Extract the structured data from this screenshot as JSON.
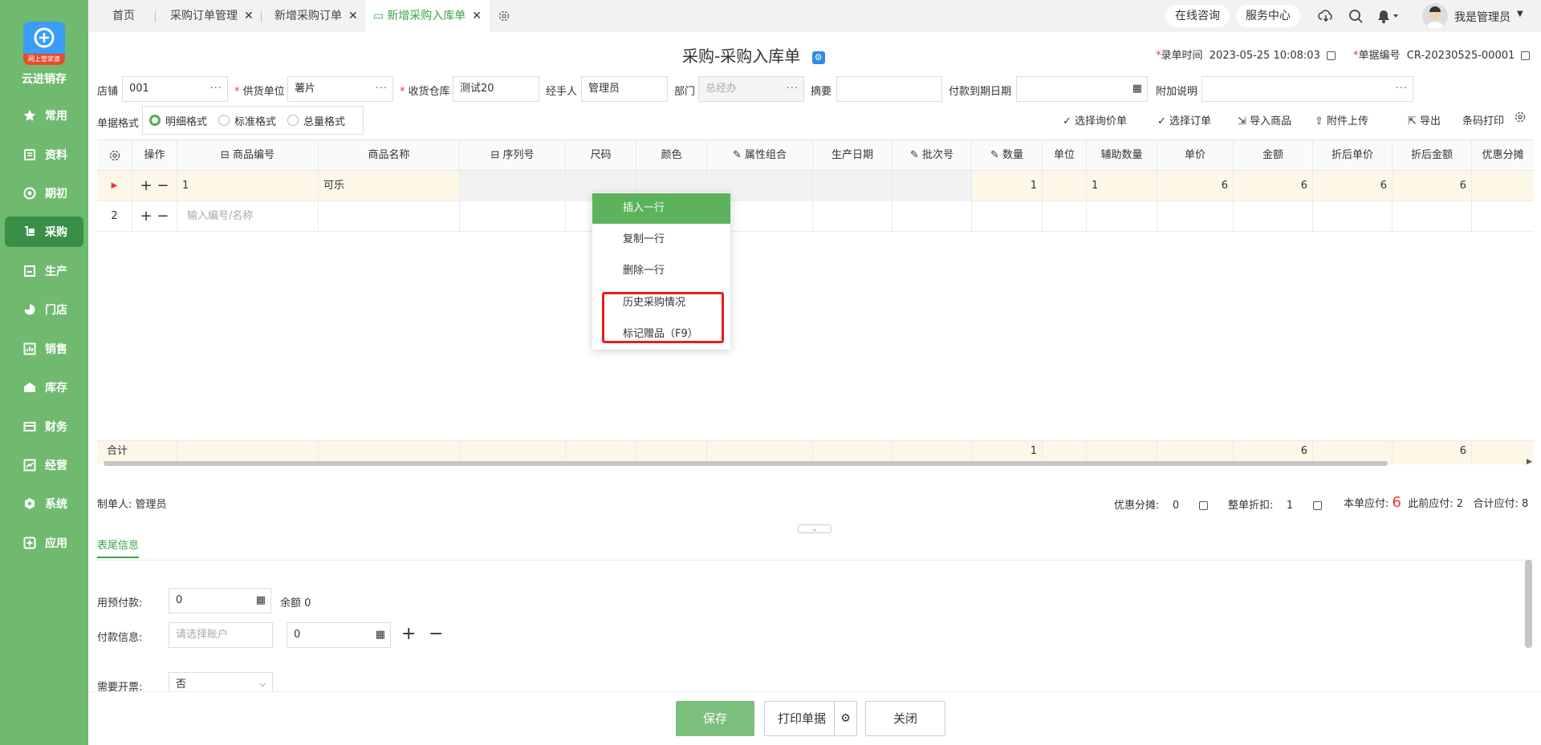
{
  "app": {
    "name": "云进销存",
    "logo_tag": "网上管家婆"
  },
  "sidebar": {
    "items": [
      {
        "label": "常用",
        "icon": "star-icon",
        "active": false
      },
      {
        "label": "资料",
        "icon": "document-icon",
        "active": false
      },
      {
        "label": "期初",
        "icon": "target-icon",
        "active": false
      },
      {
        "label": "采购",
        "icon": "cart-icon",
        "active": true
      },
      {
        "label": "生产",
        "icon": "factory-icon",
        "active": false
      },
      {
        "label": "门店",
        "icon": "pie-icon",
        "active": false
      },
      {
        "label": "销售",
        "icon": "bar-chart-icon",
        "active": false
      },
      {
        "label": "库存",
        "icon": "warehouse-icon",
        "active": false
      },
      {
        "label": "财务",
        "icon": "finance-icon",
        "active": false
      },
      {
        "label": "经营",
        "icon": "trend-icon",
        "active": false
      },
      {
        "label": "系统",
        "icon": "hexagon-gear-icon",
        "active": false
      },
      {
        "label": "应用",
        "icon": "plus-square-icon",
        "active": false
      }
    ]
  },
  "tabs": [
    {
      "label": "首页"
    },
    {
      "label": "采购订单管理"
    },
    {
      "label": "新增采购订单"
    },
    {
      "label": "新增采购入库单",
      "active": true
    }
  ],
  "topbar": {
    "consult": "在线咨询",
    "service": "服务中心",
    "user": "我是管理员"
  },
  "form": {
    "title": "采购-采购入库单",
    "record_time_label": "录单时间",
    "record_time": "2023-05-25 10:08:03",
    "doc_no_label": "单据编号",
    "doc_no": "CR-20230525-00001",
    "store_label": "店铺",
    "store": "001",
    "supplier_label": "供货单位",
    "supplier": "薯片",
    "warehouse_label": "收货仓库",
    "warehouse": "测试20",
    "handler_label": "经手人",
    "handler": "管理员",
    "dept_label": "部门",
    "dept": "总经办",
    "summary_label": "摘要",
    "summary": "",
    "due_label": "付款到期日期",
    "due": "",
    "note_label": "附加说明",
    "note": "",
    "format_label": "单据格式",
    "formats": [
      "明细格式",
      "标准格式",
      "总量格式"
    ],
    "format_selected": 0
  },
  "toolbar": {
    "inquiry": "选择询价单",
    "order": "选择订单",
    "import": "导入商品",
    "attach": "附件上传",
    "export": "导出",
    "barcode": "条码打印"
  },
  "grid": {
    "headers": [
      "操作",
      "商品编号",
      "商品名称",
      "序列号",
      "尺码",
      "颜色",
      "属性组合",
      "生产日期",
      "批次号",
      "数量",
      "单位",
      "辅助数量",
      "单价",
      "金额",
      "折后单价",
      "折后金额",
      "优惠分摊"
    ],
    "rows": [
      {
        "idx": "",
        "code": "1",
        "name": "可乐",
        "qty": "1",
        "aux": "1",
        "price": "6",
        "amount": "6",
        "disc_price": "6",
        "disc_amount": "6"
      },
      {
        "idx": "2",
        "code_placeholder": "输入编号/名称"
      }
    ],
    "total_label": "合计",
    "total_qty": "1",
    "total_amount": "6",
    "total_disc_amount": "6"
  },
  "context_menu": {
    "items": [
      "插入一行",
      "复制一行",
      "删除一行",
      "历史采购情况",
      "标记赠品（F9）"
    ]
  },
  "footer_info": {
    "maker_label": "制单人:",
    "maker": "管理员",
    "discount_share_label": "优惠分摊:",
    "discount_share": "0",
    "whole_discount_label": "整单折扣:",
    "whole_discount": "1",
    "payable_label": "本单应付:",
    "payable": "6",
    "prev_payable": "此前应付: 2",
    "total_payable": "合计应付: 8"
  },
  "tail": {
    "tab": "表尾信息",
    "prepay_label": "用预付款:",
    "prepay": "0",
    "balance": "余额 0",
    "payinfo_label": "付款信息:",
    "account_placeholder": "请选择账户",
    "payinfo_amount": "0",
    "invoice_label": "需要开票:",
    "invoice": "否"
  },
  "buttons": {
    "save": "保存",
    "print": "打印单据",
    "close": "关闭"
  },
  "colors": {
    "brand": "#6fba6f",
    "active_nav": "#3a8f46",
    "accent": "#3aa34a",
    "highlight": "#ec1c1c",
    "payable": "#e33"
  }
}
